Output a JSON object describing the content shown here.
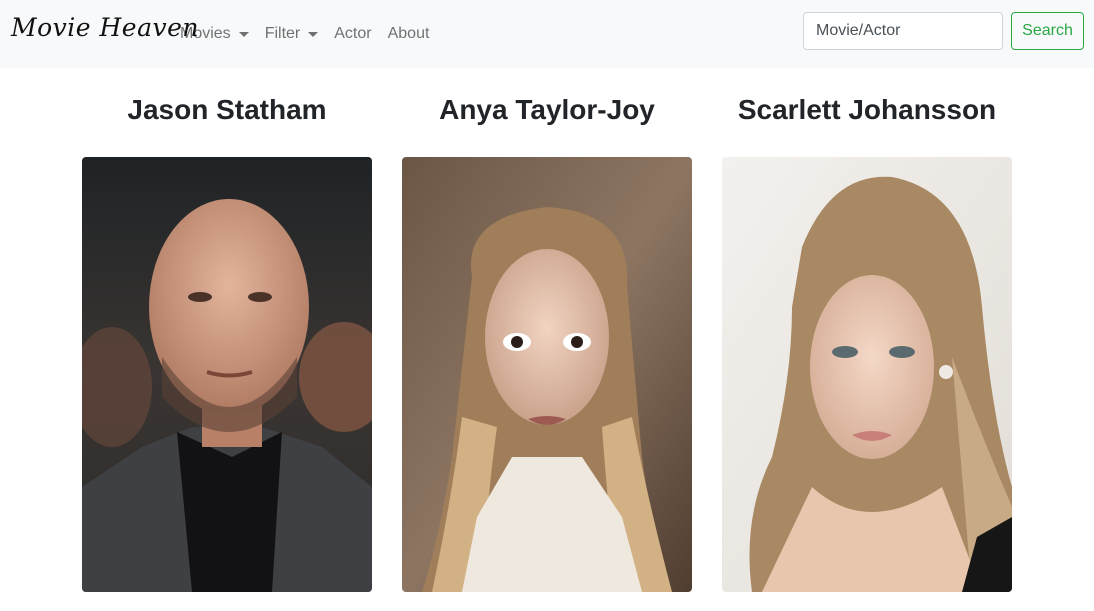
{
  "navbar": {
    "brand": "Movie Heaven",
    "links": [
      {
        "label": "Movies",
        "dropdown": true
      },
      {
        "label": "Filter",
        "dropdown": true
      },
      {
        "label": "Actor",
        "dropdown": false
      },
      {
        "label": "About",
        "dropdown": false
      }
    ],
    "search": {
      "placeholder": "Movie/Actor",
      "button_label": "Search"
    }
  },
  "colors": {
    "navbar_bg": "#f8f9fa",
    "search_button": "#28a745",
    "link": "#8c8c8c"
  },
  "actors": [
    {
      "name": "Jason Statham"
    },
    {
      "name": "Anya Taylor-Joy"
    },
    {
      "name": "Scarlett Johansson"
    }
  ]
}
